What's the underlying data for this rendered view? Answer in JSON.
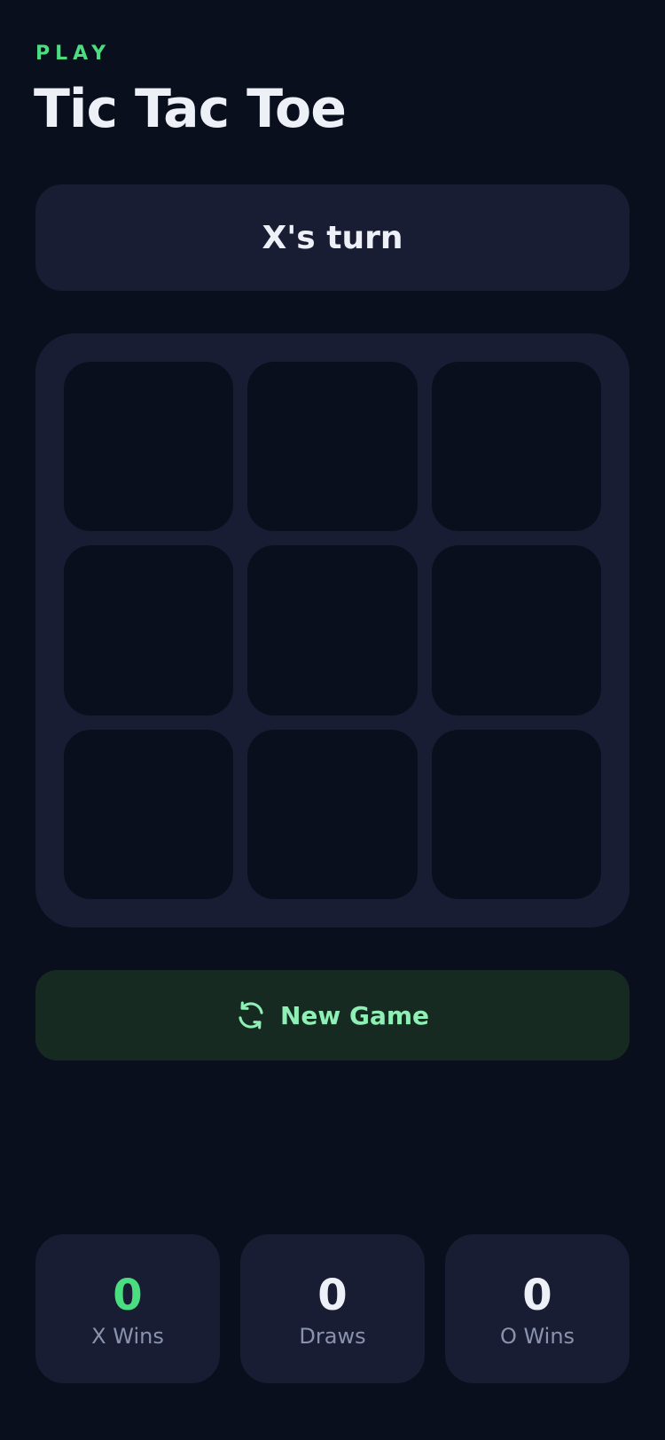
{
  "header": {
    "eyebrow": "PLAY",
    "title": "Tic Tac Toe"
  },
  "status": {
    "text": "X's turn"
  },
  "board": {
    "cells": [
      "",
      "",
      "",
      "",
      "",
      "",
      "",
      "",
      ""
    ]
  },
  "actions": {
    "new_game_label": "New Game",
    "new_game_icon": "refresh-icon"
  },
  "scores": {
    "x": {
      "value": "0",
      "label": "X Wins"
    },
    "draws": {
      "value": "0",
      "label": "Draws"
    },
    "o": {
      "value": "0",
      "label": "O Wins"
    }
  },
  "colors": {
    "background": "#0a0f1d",
    "card": "#181d33",
    "accent": "#4ade80",
    "button_bg": "#172a22",
    "button_text": "#8ef0b5",
    "muted_text": "#8a93ad"
  }
}
